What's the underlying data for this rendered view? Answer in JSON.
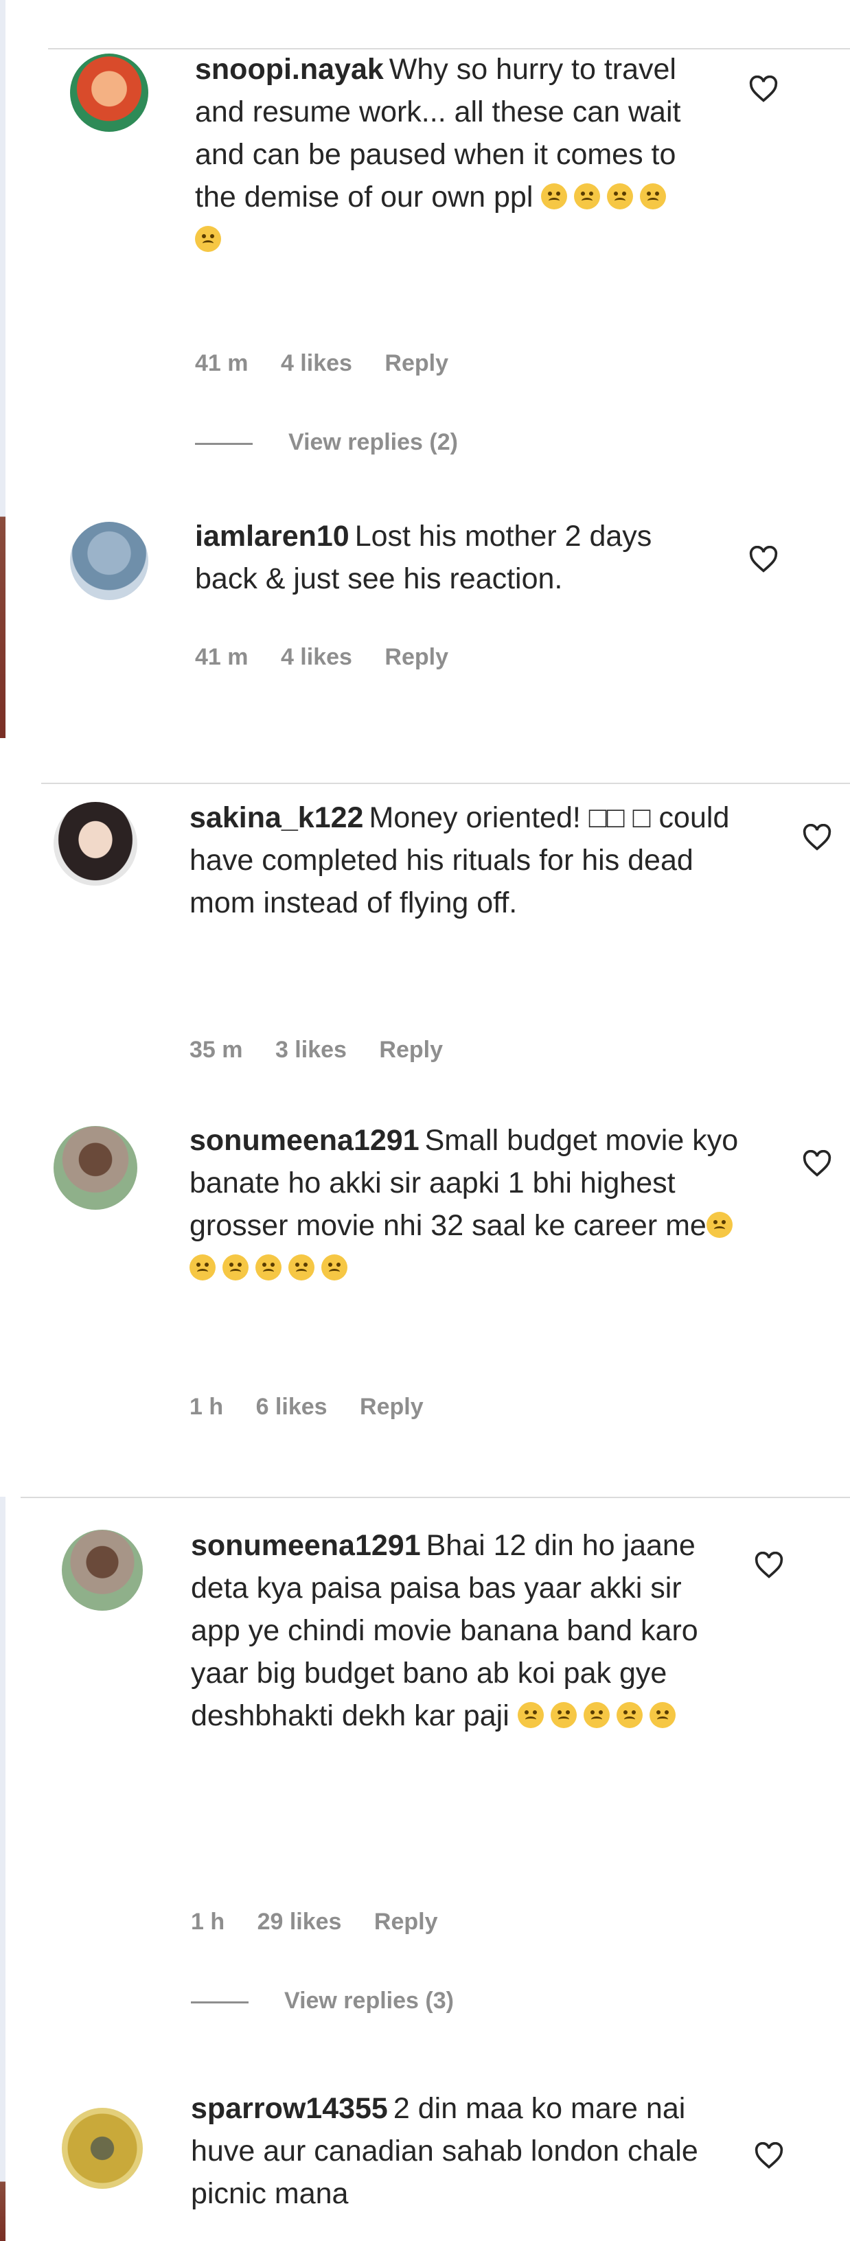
{
  "panels": [
    {
      "comments": [
        {
          "username": "snoopi.nayak",
          "text": "Why so hurry to travel and resume work... all these can wait and can be paused when it comes to the demise of our own ppl",
          "time": "41 m",
          "likes": "4 likes",
          "reply": "Reply",
          "view_replies": "View replies (2)"
        },
        {
          "username": "iamlaren10",
          "text": "Lost his mother 2 days back & just see his reaction.",
          "time": "41 m",
          "likes": "4 likes",
          "reply": "Reply"
        }
      ]
    },
    {
      "comments": [
        {
          "username": "sakina_k122",
          "text": "Money oriented! □□ □ could have completed his rituals for his dead mom instead of flying off.",
          "time": "35 m",
          "likes": "3 likes",
          "reply": "Reply"
        },
        {
          "username": "sonumeena1291",
          "text": "Small budget movie kyo banate ho akki sir aapki 1 bhi highest grosser movie nhi 32 saal ke career me",
          "time": "1 h",
          "likes": "6 likes",
          "reply": "Reply"
        }
      ]
    },
    {
      "comments": [
        {
          "username": "sonumeena1291",
          "text": "Bhai 12 din ho jaane deta kya paisa paisa bas yaar akki sir app ye chindi movie banana band karo yaar big budget bano ab koi pak gye deshbhakti dekh kar paji",
          "time": "1 h",
          "likes": "29 likes",
          "reply": "Reply",
          "view_replies": "View replies (3)"
        },
        {
          "username": "sparrow14355",
          "text": "2 din maa ko mare nai huve aur canadian sahab london chale picnic mana"
        }
      ]
    }
  ],
  "icons": {
    "like": "heart-outline-icon",
    "emoji": "sad-face-emoji-icon"
  },
  "colors": {
    "text": "#262626",
    "meta": "#8e8e8e",
    "divider": "#dbdbdb"
  }
}
